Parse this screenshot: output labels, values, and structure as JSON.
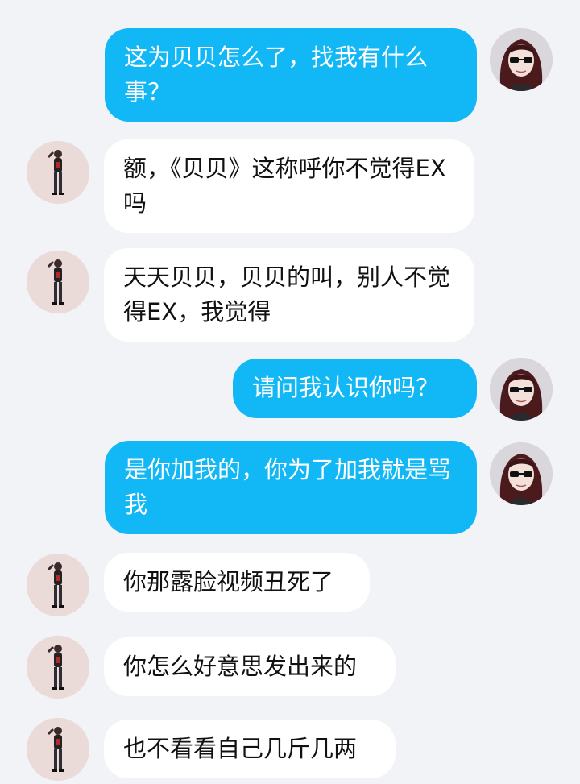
{
  "messages": [
    {
      "sender": "self",
      "text": "这为贝贝怎么了，找我有什么事？"
    },
    {
      "sender": "other",
      "text": "额，《贝贝》这称呼你不觉得EX吗"
    },
    {
      "sender": "other",
      "text": "天天贝贝，贝贝的叫，别人不觉得EX，我觉得"
    },
    {
      "sender": "self",
      "text": "请问我认识你吗？"
    },
    {
      "sender": "self",
      "text": "是你加我的，你为了加我就是骂我"
    },
    {
      "sender": "other",
      "text": "你那露脸视频丑死了"
    },
    {
      "sender": "other",
      "text": "你怎么好意思发出来的"
    },
    {
      "sender": "other",
      "text": "也不看看自己几斤几两"
    }
  ],
  "colors": {
    "background": "#f2f3f7",
    "self_bubble": "#12b7f5",
    "other_bubble": "#ffffff"
  },
  "icons": {
    "self_avatar": "anime-girl-sunglasses-avatar",
    "other_avatar": "standing-figure-avatar"
  }
}
